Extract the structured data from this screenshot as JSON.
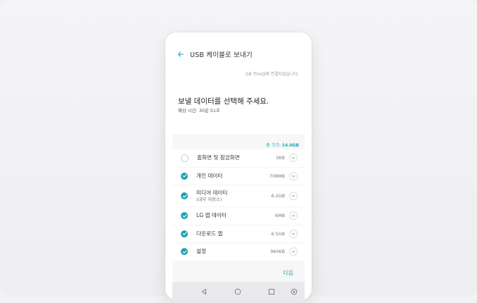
{
  "appbar": {
    "title": "USB 케이블로 보내기"
  },
  "connected_text": "G8 ThinQ에 연결되었습니다.",
  "heading": "보낼 데이터를 선택해 주세요.",
  "estimated_time": "예상 시간: 30분 51초",
  "total": {
    "label": "총 크기:",
    "value": "14.0GB"
  },
  "items": [
    {
      "label": "홈화면 및 잠금화면",
      "sub": "",
      "size": "0KB",
      "checked": false
    },
    {
      "label": "개인 데이터",
      "sub": "",
      "size": "708MB",
      "checked": true
    },
    {
      "label": "미디어 데이터",
      "sub": "(내부 저장소)",
      "size": "6.2GB",
      "checked": true
    },
    {
      "label": "LG 앱 데이터",
      "sub": "",
      "size": "6MB",
      "checked": true
    },
    {
      "label": "다운로드 앱",
      "sub": "",
      "size": "6.5GB",
      "checked": true
    },
    {
      "label": "설정",
      "sub": "",
      "size": "960KB",
      "checked": true
    }
  ],
  "next_label": "다음",
  "colors": {
    "accent": "#1fa3b8",
    "text": "#333333",
    "muted": "#9b9b9b"
  },
  "icons": [
    "back-arrow-icon",
    "check-icon",
    "chevron-down-icon",
    "nav-back-icon",
    "nav-home-icon",
    "nav-recents-icon",
    "nav-extra-icon"
  ]
}
